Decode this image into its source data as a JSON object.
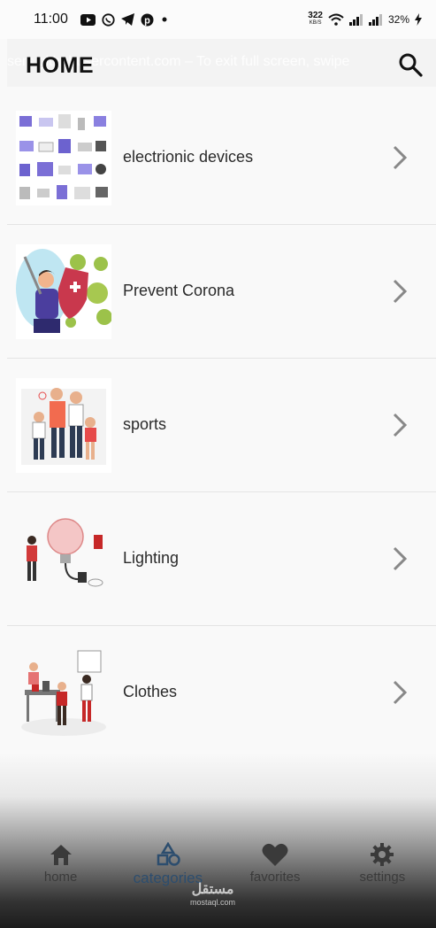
{
  "status_bar": {
    "time": "11:00",
    "net_speed_value": "322",
    "net_speed_unit": "KB/S",
    "battery": "32%"
  },
  "app_bar": {
    "title": "HOME",
    "toast": "sers.githubusercontent.com – To exit full screen, swipe"
  },
  "categories": [
    {
      "label": "electrionic devices",
      "icon": "devices-illustration"
    },
    {
      "label": "Prevent Corona",
      "icon": "corona-illustration"
    },
    {
      "label": "sports",
      "icon": "sports-illustration"
    },
    {
      "label": "Lighting",
      "icon": "lighting-illustration"
    },
    {
      "label": "Clothes",
      "icon": "clothes-illustration"
    }
  ],
  "bottom_nav": {
    "items": [
      {
        "label": "home",
        "icon": "home-icon",
        "active": false
      },
      {
        "label": "categories",
        "icon": "categories-icon",
        "active": true
      },
      {
        "label": "favorites",
        "icon": "heart-icon",
        "active": false
      },
      {
        "label": "settings",
        "icon": "gear-icon",
        "active": false
      }
    ]
  },
  "watermark": {
    "arabic": "مستقل",
    "latin": "mostaql.com"
  },
  "colors": {
    "active_nav": "#2c4d6e",
    "background": "#f9f9f9",
    "chevron": "#888888"
  }
}
